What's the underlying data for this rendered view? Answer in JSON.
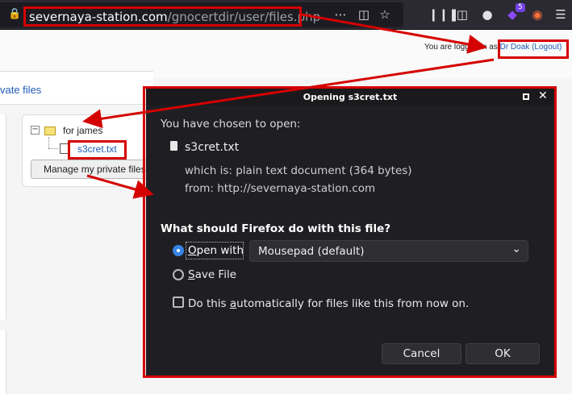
{
  "browser": {
    "url_host": "severnaya-station.com",
    "url_path": "/gnocertdir/user/files.php",
    "addon_badge": "5"
  },
  "page": {
    "logged_prefix": "You are logged in as ",
    "user_link": "Dr Doak",
    "logout_link": "(Logout)",
    "nav_link": "vate files",
    "folder_label": "for james",
    "file_label": "s3cret.txt",
    "manage_button": "Manage my private files"
  },
  "dialog": {
    "title": "Opening s3cret.txt",
    "chosen_text": "You have chosen to open:",
    "filename": "s3cret.txt",
    "which_is": "which is:  plain text document (364 bytes)",
    "from": "from:  http://severnaya-station.com",
    "question": "What should Firefox do with this file?",
    "open_with_label": "Open with",
    "open_with_app": "Mousepad (default)",
    "save_file_label": "Save File",
    "auto_label": "Do this automatically for files like this from now on.",
    "cancel": "Cancel",
    "ok": "OK",
    "open_with_selected": true,
    "auto_checked": false
  },
  "annotations": {
    "box_color": "#d50000"
  }
}
